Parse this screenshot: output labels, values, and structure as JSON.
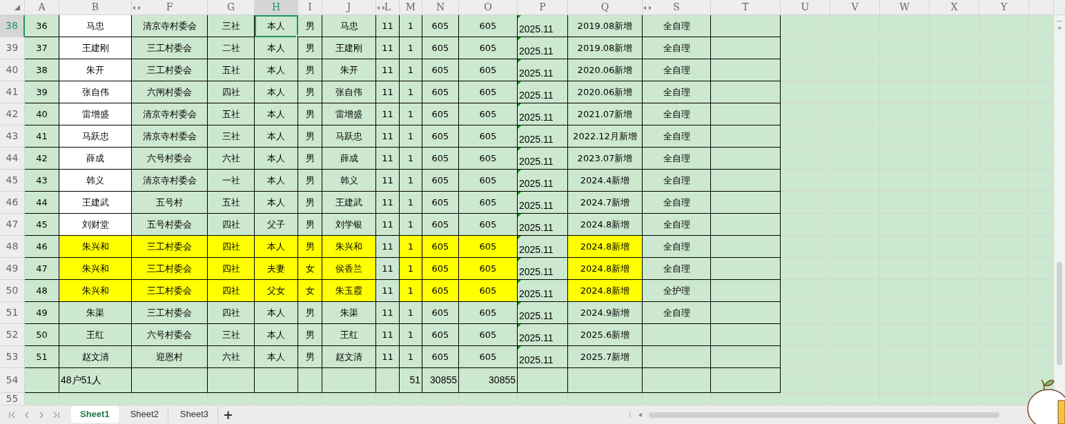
{
  "columns": [
    {
      "label": "A",
      "selected": false,
      "hidden_before": false
    },
    {
      "label": "B",
      "selected": false,
      "hidden_before": false
    },
    {
      "label": "F",
      "selected": false,
      "hidden_before": true
    },
    {
      "label": "G",
      "selected": false,
      "hidden_before": false
    },
    {
      "label": "H",
      "selected": true,
      "hidden_before": false
    },
    {
      "label": "I",
      "selected": false,
      "hidden_before": false
    },
    {
      "label": "J",
      "selected": false,
      "hidden_before": false
    },
    {
      "label": "L",
      "selected": false,
      "hidden_before": true
    },
    {
      "label": "M",
      "selected": false,
      "hidden_before": false
    },
    {
      "label": "N",
      "selected": false,
      "hidden_before": false
    },
    {
      "label": "O",
      "selected": false,
      "hidden_before": false
    },
    {
      "label": "P",
      "selected": false,
      "hidden_before": false
    },
    {
      "label": "Q",
      "selected": false,
      "hidden_before": false
    },
    {
      "label": "S",
      "selected": false,
      "hidden_before": true
    },
    {
      "label": "T",
      "selected": false,
      "hidden_before": false
    },
    {
      "label": "U",
      "selected": false,
      "hidden_before": false
    },
    {
      "label": "V",
      "selected": false,
      "hidden_before": false
    },
    {
      "label": "W",
      "selected": false,
      "hidden_before": false
    },
    {
      "label": "X",
      "selected": false,
      "hidden_before": false
    },
    {
      "label": "Y",
      "selected": false,
      "hidden_before": false
    }
  ],
  "rows": [
    {
      "number": "38",
      "kind": "data",
      "selected": true,
      "cells": [
        {
          "text": "36"
        },
        {
          "text": "马忠",
          "color": "#ffffff"
        },
        {
          "text": "清京寺村委会"
        },
        {
          "text": "三社"
        },
        {
          "text": "本人",
          "selected": true
        },
        {
          "text": "男"
        },
        {
          "text": "马忠"
        },
        {
          "text": "11"
        },
        {
          "text": "1"
        },
        {
          "text": "605"
        },
        {
          "text": "605"
        },
        {
          "text": "2025.11",
          "flag": true
        },
        {
          "text": "2019.08新增"
        },
        {
          "text": "全自理"
        }
      ]
    },
    {
      "number": "39",
      "kind": "data",
      "selected": false,
      "cells": [
        {
          "text": "37"
        },
        {
          "text": "王建刚",
          "color": "#ffffff"
        },
        {
          "text": "三工村委会"
        },
        {
          "text": "二社"
        },
        {
          "text": "本人"
        },
        {
          "text": "男"
        },
        {
          "text": "王建刚"
        },
        {
          "text": "11"
        },
        {
          "text": "1"
        },
        {
          "text": "605"
        },
        {
          "text": "605"
        },
        {
          "text": "2025.11",
          "flag": true
        },
        {
          "text": "2019.08新增"
        },
        {
          "text": "全自理"
        }
      ]
    },
    {
      "number": "40",
      "kind": "data",
      "selected": false,
      "cells": [
        {
          "text": "38"
        },
        {
          "text": "朱开",
          "color": "#ffffff"
        },
        {
          "text": "三工村委会"
        },
        {
          "text": "五社"
        },
        {
          "text": "本人"
        },
        {
          "text": "男"
        },
        {
          "text": "朱开"
        },
        {
          "text": "11"
        },
        {
          "text": "1"
        },
        {
          "text": "605"
        },
        {
          "text": "605"
        },
        {
          "text": "2025.11",
          "flag": true
        },
        {
          "text": "2020.06新增"
        },
        {
          "text": "全自理"
        }
      ]
    },
    {
      "number": "41",
      "kind": "data",
      "selected": false,
      "cells": [
        {
          "text": "39"
        },
        {
          "text": "张自伟",
          "color": "#ffffff"
        },
        {
          "text": "六闸村委会"
        },
        {
          "text": "四社"
        },
        {
          "text": "本人"
        },
        {
          "text": "男"
        },
        {
          "text": "张自伟"
        },
        {
          "text": "11"
        },
        {
          "text": "1"
        },
        {
          "text": "605"
        },
        {
          "text": "605"
        },
        {
          "text": "2025.11",
          "flag": true
        },
        {
          "text": "2020.06新增"
        },
        {
          "text": "全自理"
        }
      ]
    },
    {
      "number": "42",
      "kind": "data",
      "selected": false,
      "cells": [
        {
          "text": "40"
        },
        {
          "text": "雷增盛",
          "color": "#ffffff"
        },
        {
          "text": "清京寺村委会"
        },
        {
          "text": "五社"
        },
        {
          "text": "本人"
        },
        {
          "text": "男"
        },
        {
          "text": "雷增盛"
        },
        {
          "text": "11"
        },
        {
          "text": "1"
        },
        {
          "text": "605"
        },
        {
          "text": "605"
        },
        {
          "text": "2025.11",
          "flag": true
        },
        {
          "text": "2021.07新增"
        },
        {
          "text": "全自理"
        }
      ]
    },
    {
      "number": "43",
      "kind": "data",
      "selected": false,
      "cells": [
        {
          "text": "41"
        },
        {
          "text": "马跃忠",
          "color": "#ffffff"
        },
        {
          "text": "清京寺村委会"
        },
        {
          "text": "三社"
        },
        {
          "text": "本人"
        },
        {
          "text": "男"
        },
        {
          "text": "马跃忠"
        },
        {
          "text": "11"
        },
        {
          "text": "1"
        },
        {
          "text": "605"
        },
        {
          "text": "605"
        },
        {
          "text": "2025.11",
          "flag": true
        },
        {
          "text": "2022.12月新增"
        },
        {
          "text": "全自理"
        }
      ]
    },
    {
      "number": "44",
      "kind": "data",
      "selected": false,
      "cells": [
        {
          "text": "42"
        },
        {
          "text": "薛成",
          "color": "#ffffff"
        },
        {
          "text": "六号村委会"
        },
        {
          "text": "六社"
        },
        {
          "text": "本人"
        },
        {
          "text": "男"
        },
        {
          "text": "薛成"
        },
        {
          "text": "11"
        },
        {
          "text": "1"
        },
        {
          "text": "605"
        },
        {
          "text": "605"
        },
        {
          "text": "2025.11",
          "flag": true
        },
        {
          "text": "2023.07新增"
        },
        {
          "text": "全自理"
        }
      ]
    },
    {
      "number": "45",
      "kind": "data",
      "selected": false,
      "cells": [
        {
          "text": "43"
        },
        {
          "text": "韩义",
          "color": "#ffffff"
        },
        {
          "text": "清京寺村委会"
        },
        {
          "text": "一社"
        },
        {
          "text": "本人"
        },
        {
          "text": "男"
        },
        {
          "text": "韩义"
        },
        {
          "text": "11"
        },
        {
          "text": "1"
        },
        {
          "text": "605"
        },
        {
          "text": "605"
        },
        {
          "text": "2025.11",
          "flag": true
        },
        {
          "text": "2024.4新增"
        },
        {
          "text": "全自理"
        }
      ]
    },
    {
      "number": "46",
      "kind": "data",
      "selected": false,
      "cells": [
        {
          "text": "44"
        },
        {
          "text": "王建武",
          "color": "#ffffff"
        },
        {
          "text": "五号村"
        },
        {
          "text": "五社"
        },
        {
          "text": "本人"
        },
        {
          "text": "男"
        },
        {
          "text": "王建武"
        },
        {
          "text": "11"
        },
        {
          "text": "1"
        },
        {
          "text": "605"
        },
        {
          "text": "605"
        },
        {
          "text": "2025.11",
          "flag": true
        },
        {
          "text": "2024.7新增"
        },
        {
          "text": "全自理"
        }
      ]
    },
    {
      "number": "47",
      "kind": "data",
      "selected": false,
      "cells": [
        {
          "text": "45"
        },
        {
          "text": "刘财堂",
          "color": "#ffffff"
        },
        {
          "text": "五号村委会"
        },
        {
          "text": "四社"
        },
        {
          "text": "父子"
        },
        {
          "text": "男"
        },
        {
          "text": "刘学银"
        },
        {
          "text": "11"
        },
        {
          "text": "1"
        },
        {
          "text": "605"
        },
        {
          "text": "605"
        },
        {
          "text": "2025.11",
          "flag": true
        },
        {
          "text": "2024.8新增"
        },
        {
          "text": "全自理"
        }
      ]
    },
    {
      "number": "48",
      "kind": "data",
      "selected": false,
      "cells": [
        {
          "text": "46"
        },
        {
          "text": "朱兴和",
          "color": "#ffff00"
        },
        {
          "text": "三工村委会",
          "color": "#ffff00"
        },
        {
          "text": "四社",
          "color": "#ffff00"
        },
        {
          "text": "本人",
          "color": "#ffff00"
        },
        {
          "text": "男",
          "color": "#ffff00"
        },
        {
          "text": "朱兴和",
          "color": "#ffff00"
        },
        {
          "text": "11"
        },
        {
          "text": "1",
          "color": "#ffff00"
        },
        {
          "text": "605",
          "color": "#ffff00"
        },
        {
          "text": "605",
          "color": "#ffff00"
        },
        {
          "text": "2025.11",
          "flag": true
        },
        {
          "text": "2024.8新增",
          "color": "#ffff00"
        },
        {
          "text": "全自理"
        }
      ]
    },
    {
      "number": "49",
      "kind": "data",
      "selected": false,
      "cells": [
        {
          "text": "47"
        },
        {
          "text": "朱兴和",
          "color": "#ffff00"
        },
        {
          "text": "三工村委会",
          "color": "#ffff00"
        },
        {
          "text": "四社",
          "color": "#ffff00"
        },
        {
          "text": "夫妻",
          "color": "#ffff00"
        },
        {
          "text": "女",
          "color": "#ffff00"
        },
        {
          "text": "侯香兰",
          "color": "#ffff00"
        },
        {
          "text": "11"
        },
        {
          "text": "1",
          "color": "#ffff00"
        },
        {
          "text": "605",
          "color": "#ffff00"
        },
        {
          "text": "605",
          "color": "#ffff00"
        },
        {
          "text": "2025.11",
          "flag": true
        },
        {
          "text": "2024.8新增",
          "color": "#ffff00"
        },
        {
          "text": "全自理"
        }
      ]
    },
    {
      "number": "50",
      "kind": "data",
      "selected": false,
      "cells": [
        {
          "text": "48"
        },
        {
          "text": "朱兴和",
          "color": "#ffff00"
        },
        {
          "text": "三工村委会",
          "color": "#ffff00"
        },
        {
          "text": "四社",
          "color": "#ffff00"
        },
        {
          "text": "父女",
          "color": "#ffff00"
        },
        {
          "text": "女",
          "color": "#ffff00"
        },
        {
          "text": "朱玉霞",
          "color": "#ffff00"
        },
        {
          "text": "11"
        },
        {
          "text": "1",
          "color": "#ffff00"
        },
        {
          "text": "605",
          "color": "#ffff00"
        },
        {
          "text": "605",
          "color": "#ffff00"
        },
        {
          "text": "2025.11",
          "flag": true
        },
        {
          "text": "2024.8新增",
          "color": "#ffff00"
        },
        {
          "text": "全护理"
        }
      ]
    },
    {
      "number": "51",
      "kind": "data",
      "selected": false,
      "cells": [
        {
          "text": "49"
        },
        {
          "text": "朱渠"
        },
        {
          "text": "三工村委会"
        },
        {
          "text": "四社"
        },
        {
          "text": "本人"
        },
        {
          "text": "男"
        },
        {
          "text": "朱渠"
        },
        {
          "text": "11"
        },
        {
          "text": "1"
        },
        {
          "text": "605"
        },
        {
          "text": "605"
        },
        {
          "text": "2025.11",
          "flag": true
        },
        {
          "text": "2024.9新增"
        },
        {
          "text": "全自理"
        }
      ]
    },
    {
      "number": "52",
      "kind": "data",
      "selected": false,
      "cells": [
        {
          "text": "50"
        },
        {
          "text": "王红"
        },
        {
          "text": "六号村委会"
        },
        {
          "text": "三社"
        },
        {
          "text": "本人"
        },
        {
          "text": "男"
        },
        {
          "text": "王红"
        },
        {
          "text": "11"
        },
        {
          "text": "1"
        },
        {
          "text": "605"
        },
        {
          "text": "605"
        },
        {
          "text": "2025.11",
          "flag": true
        },
        {
          "text": "2025.6新增"
        },
        {}
      ]
    },
    {
      "number": "53",
      "kind": "data",
      "selected": false,
      "cells": [
        {
          "text": "51"
        },
        {
          "text": "赵文清"
        },
        {
          "text": "迎恩村"
        },
        {
          "text": "六社"
        },
        {
          "text": "本人"
        },
        {
          "text": "男"
        },
        {
          "text": "赵文清"
        },
        {
          "text": "11"
        },
        {
          "text": "1"
        },
        {
          "text": "605"
        },
        {
          "text": "605"
        },
        {
          "text": "2025.11",
          "flag": true
        },
        {
          "text": "2025.7新增"
        },
        {}
      ]
    },
    {
      "number": "54",
      "kind": "total",
      "selected": false,
      "cells": [
        {},
        {
          "text": "48户51人"
        },
        {},
        {},
        {},
        {},
        {},
        {},
        {
          "text": "51"
        },
        {
          "text": "30855"
        },
        {
          "text": "30855"
        },
        {},
        {},
        {}
      ]
    },
    {
      "number": "55",
      "kind": "blank",
      "selected": false,
      "cells": []
    }
  ],
  "sheet_tabs": [
    {
      "label": "Sheet1",
      "selected": true
    },
    {
      "label": "Sheet2",
      "selected": false
    },
    {
      "label": "Sheet3",
      "selected": false
    }
  ],
  "add_sheet": "+"
}
